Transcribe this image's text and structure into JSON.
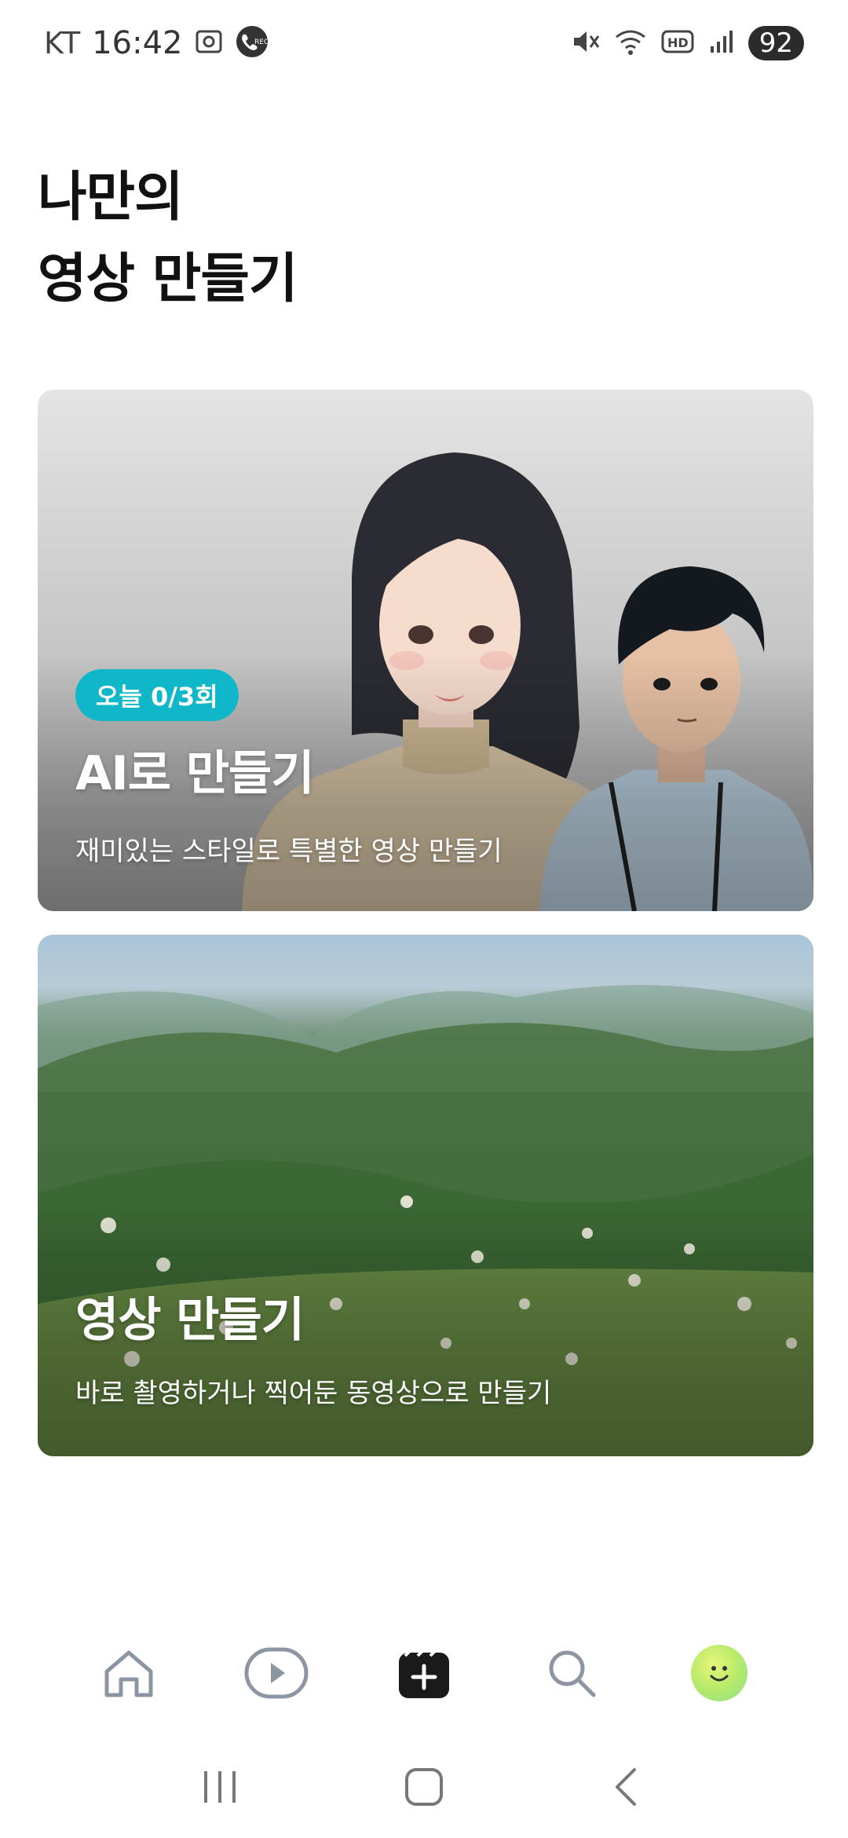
{
  "status_bar": {
    "carrier": "KT",
    "time": "16:42",
    "battery": "92",
    "icons": [
      "screenshot-icon",
      "call-record-icon",
      "mute-icon",
      "wifi-icon",
      "hd-icon",
      "signal-icon"
    ]
  },
  "page": {
    "title_line1": "나만의",
    "title_line2": "영상 만들기"
  },
  "cards": {
    "ai": {
      "badge": "오늘 0/3회",
      "title": "AI로 만들기",
      "subtitle": "재미있는 스타일로 특별한 영상 만들기"
    },
    "video": {
      "title": "영상 만들기",
      "subtitle": "바로 촬영하거나 찍어둔 동영상으로 만들기"
    }
  },
  "bottom_nav": {
    "items": [
      {
        "icon": "home-icon",
        "active": false
      },
      {
        "icon": "play-icon",
        "active": false
      },
      {
        "icon": "create-icon",
        "active": true
      },
      {
        "icon": "search-icon",
        "active": false
      },
      {
        "icon": "profile-avatar",
        "active": false
      }
    ]
  },
  "system_nav": {
    "items": [
      "recents-icon",
      "home-button-icon",
      "back-icon"
    ]
  },
  "colors": {
    "badge": "#0fb7c9",
    "nav_inactive": "#8c96a3",
    "nav_active": "#1a1a1a"
  }
}
